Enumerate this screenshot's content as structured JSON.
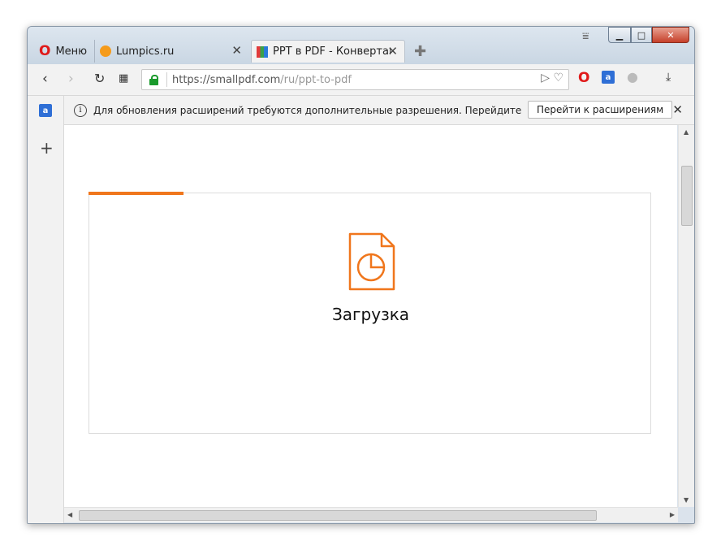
{
  "tabs": {
    "menu_label": "Меню",
    "tab1_label": "Lumpics.ru",
    "tab2_label": "PPT в PDF - Конвертация"
  },
  "address": {
    "host": "https://smallpdf.com",
    "path": "/ru/ppt-to-pdf"
  },
  "infobar": {
    "text": "Для обновления расширений требуются дополнительные разрешения. Перейдите в менедже...",
    "button_label": "Перейти к расширениям"
  },
  "page": {
    "upload_label": "Загрузка",
    "progress_fraction": 0.17
  },
  "colors": {
    "accent": "#f0761c",
    "lock": "#1a9a2c"
  },
  "icons": [
    "opera-logo-icon",
    "lumpics-favicon-icon",
    "smallpdf-favicon-icon",
    "close-icon",
    "plus-icon",
    "back-icon",
    "forward-icon",
    "reload-icon",
    "speed-dial-icon",
    "lock-icon",
    "send-icon",
    "heart-icon",
    "translate-icon",
    "vpn-globe-icon",
    "download-icon",
    "info-icon",
    "file-chart-icon"
  ]
}
